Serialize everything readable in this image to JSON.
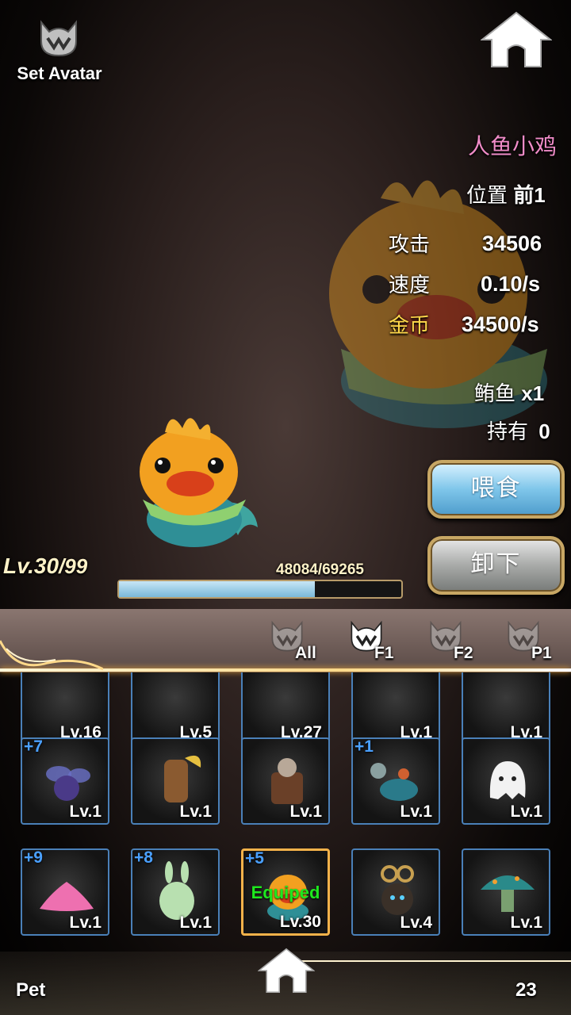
{
  "header": {
    "avatar_label": "Set Avatar"
  },
  "pet": {
    "name": "人鱼小鸡",
    "position_label": "位置",
    "position_value": "前1",
    "attack_label": "攻击",
    "attack_value": "34506",
    "speed_label": "速度",
    "speed_value": "0.10/s",
    "gold_label": "金币",
    "gold_value": "34500/s",
    "food_label": "鲔鱼",
    "food_value": "x1",
    "owned_label": "持有",
    "owned_value": "0",
    "level": "Lv.30",
    "max_level": "/99",
    "exp_text": "48084/69265",
    "exp_fraction": 0.694
  },
  "actions": {
    "feed_label": "喂食",
    "unload_label": "卸下"
  },
  "tabs": [
    {
      "label": "All"
    },
    {
      "label": "F1"
    },
    {
      "label": "F2"
    },
    {
      "label": "P1"
    }
  ],
  "grid": {
    "row1": [
      "Lv.16",
      "Lv.5",
      "Lv.27",
      "Lv.1",
      "Lv.1"
    ],
    "row2": [
      {
        "plus": "+7",
        "lv": "Lv.1"
      },
      {
        "plus": "",
        "lv": "Lv.1"
      },
      {
        "plus": "",
        "lv": "Lv.1"
      },
      {
        "plus": "+1",
        "lv": "Lv.1"
      },
      {
        "plus": "",
        "lv": "Lv.1"
      }
    ],
    "row3": [
      {
        "plus": "+9",
        "lv": "Lv.1"
      },
      {
        "plus": "+8",
        "lv": "Lv.1"
      },
      {
        "plus": "+5",
        "lv": "Lv.30",
        "status": "Equiped"
      },
      {
        "plus": "",
        "lv": "Lv.4"
      },
      {
        "plus": "",
        "lv": "Lv.1"
      }
    ]
  },
  "footer": {
    "label": "Pet",
    "count": "23"
  },
  "colors": {
    "pet_name": "#f08cc8",
    "gold_label": "#ffd84a",
    "plus": "#4aa0ff",
    "equipped": "#1ee81e",
    "cell_border": "#4a80b8",
    "selected_border": "#f4b24a"
  },
  "icons": [
    "cat-emblem-icon",
    "home-icon"
  ]
}
